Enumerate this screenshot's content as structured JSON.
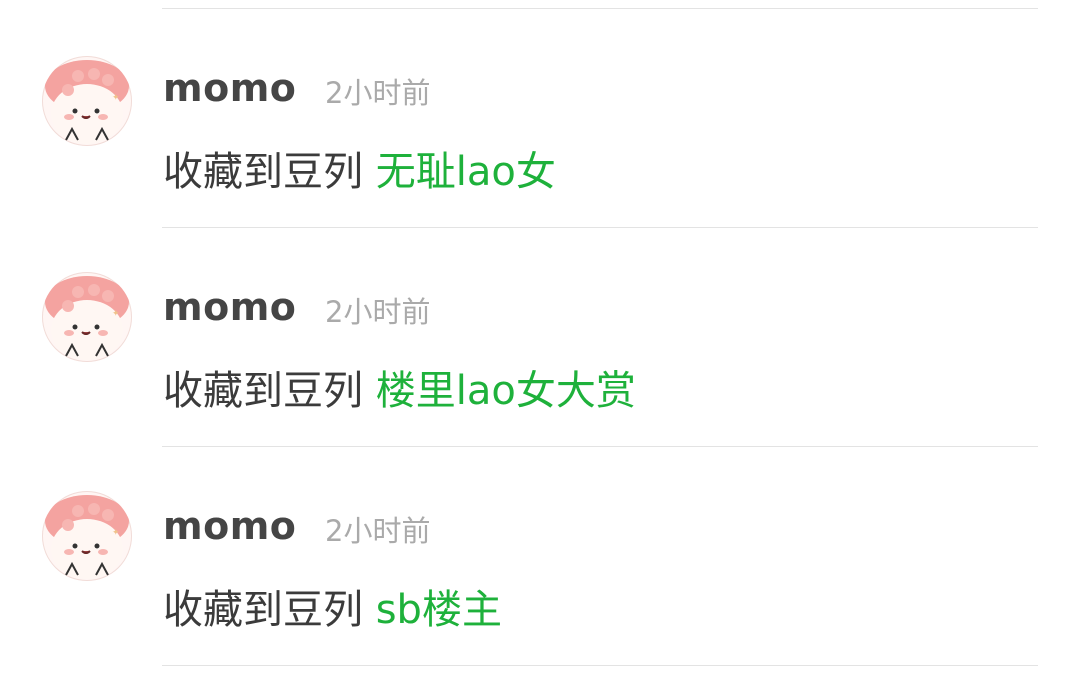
{
  "feed": [
    {
      "username": "momo",
      "time": "2小时前",
      "action": "收藏到豆列",
      "target": "无耻lao女"
    },
    {
      "username": "momo",
      "time": "2小时前",
      "action": "收藏到豆列",
      "target": "楼里lao女大赏"
    },
    {
      "username": "momo",
      "time": "2小时前",
      "action": "收藏到豆列",
      "target": "sb楼主"
    }
  ],
  "colors": {
    "link": "#1eb13b",
    "username": "#454545",
    "time": "#aaaaaa",
    "divider": "#e3e3e3"
  }
}
